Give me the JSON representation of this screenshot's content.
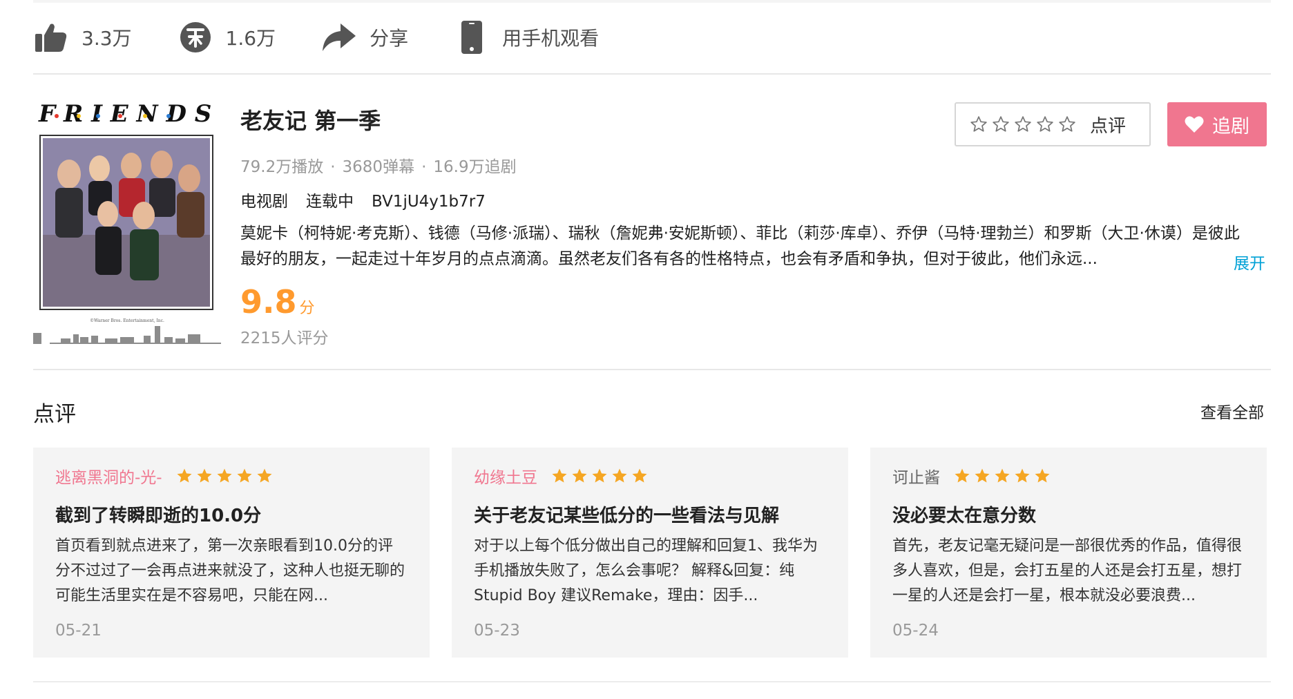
{
  "actions": {
    "like_count": "3.3万",
    "coin_count": "1.6万",
    "share_label": "分享",
    "mobile_label": "用手机观看"
  },
  "show": {
    "logo_text": "F·R·I·E·N·D·S",
    "title": "老友记 第一季",
    "plays": "79.2万播放",
    "danmaku": "3680弹幕",
    "follows": "16.9万追剧",
    "dot": "·",
    "type": "电视剧",
    "status": "连载中",
    "bvid": "BV1jU4y1b7r7",
    "description": "莫妮卡（柯特妮·考克斯）、钱德（马修·派瑞）、瑞秋（詹妮弗·安妮斯顿）、菲比（莉莎·库卓）、乔伊（马特·理勃兰）和罗斯（大卫·休谟）是彼此最好的朋友，一起走过十年岁月的点点滴滴。虽然老友们各有各的性格特点，也会有矛盾和争执，但对于彼此，他们永远...",
    "expand_label": "展开",
    "score": "9.8",
    "score_unit": "分",
    "score_count": "2215人评分",
    "rate_label": "点评",
    "follow_label": "追剧"
  },
  "reviews": {
    "section_title": "点评",
    "see_all": "查看全部",
    "items": [
      {
        "author": "逃离黑洞的-光-",
        "author_color": "#f0768f",
        "stars": 5,
        "title": "截到了转瞬即逝的10.0分",
        "body": "首页看到就点进来了，第一次亲眼看到10.0分的评分不过过了一会再点进来就没了，这种人也挺无聊的可能生活里实在是不容易吧，只能在网...",
        "date": "05-21"
      },
      {
        "author": "幼缘土豆",
        "author_color": "#f0768f",
        "stars": 5,
        "title": "关于老友记某些低分的一些看法与见解",
        "body": "对于以上每个低分做出自己的理解和回复1、我华为手机播放失败了，怎么会事呢？ 解释&回复：纯Stupid Boy 建议Remake，理由：因手...",
        "date": "05-23"
      },
      {
        "author": "诃止酱",
        "author_color": "#666666",
        "stars": 5,
        "title": "没必要太在意分数",
        "body": "首先，老友记毫无疑问是一部很优秀的作品，值得很多人喜欢，但是，会打五星的人还是会打五星，想打一星的人还是会打一星，根本就没必要浪费...",
        "date": "05-24"
      }
    ]
  },
  "colors": {
    "accent_pink": "#f0768f",
    "score_orange": "#ff9a2e",
    "link_blue": "#00a1d6",
    "star_gold": "#f5a623"
  },
  "icons": [
    "thumbs-up-icon",
    "coin-icon",
    "share-arrow-icon",
    "phone-icon",
    "star-outline-icon",
    "heart-icon",
    "star-filled-icon"
  ]
}
